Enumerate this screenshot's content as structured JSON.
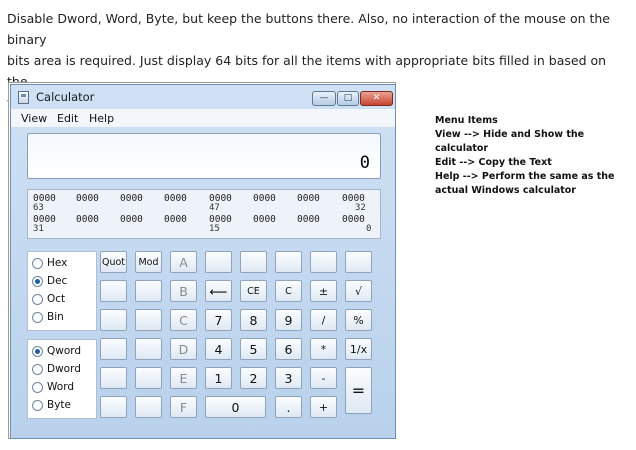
{
  "instructions": [
    "Disable Dword, Word, Byte, but keep the buttons there. Also, no interaction of the mouse on the binary",
    "bits area is required. Just display 64 bits for all the items with appropriate bits filled in based on the",
    "value in the number field."
  ],
  "window": {
    "title": "Calculator",
    "controls": {
      "minimize": "—",
      "maximize": "□",
      "close": "✕"
    }
  },
  "menu": [
    "View",
    "Edit",
    "Help"
  ],
  "display": {
    "value": "0"
  },
  "bits": {
    "groups_row1": [
      "0000",
      "0000",
      "0000",
      "0000",
      "0000",
      "0000",
      "0000",
      "0000"
    ],
    "groups_row2": [
      "0000",
      "0000",
      "0000",
      "0000",
      "0000",
      "0000",
      "0000",
      "0000"
    ],
    "labels_row1": [
      "63",
      "47",
      "32"
    ],
    "labels_row2": [
      "31",
      "15",
      "0"
    ]
  },
  "radios": {
    "base": [
      {
        "label": "Hex",
        "selected": false
      },
      {
        "label": "Dec",
        "selected": true
      },
      {
        "label": "Oct",
        "selected": false
      },
      {
        "label": "Bin",
        "selected": false
      }
    ],
    "word": [
      {
        "label": "Qword",
        "selected": true
      },
      {
        "label": "Dword",
        "selected": false
      },
      {
        "label": "Word",
        "selected": false
      },
      {
        "label": "Byte",
        "selected": false
      }
    ]
  },
  "buttons": {
    "quot": "Quot",
    "mod": "Mod",
    "A": "A",
    "B": "B",
    "C": "C",
    "D": "D",
    "E": "E",
    "F": "F",
    "backspace": "⟵",
    "ce": "CE",
    "c": "C",
    "plusminus": "±",
    "sqrt": "√",
    "n7": "7",
    "n8": "8",
    "n9": "9",
    "divide": "/",
    "percent": "%",
    "n4": "4",
    "n5": "5",
    "n6": "6",
    "multiply": "*",
    "reciprocal": "1/x",
    "n1": "1",
    "n2": "2",
    "n3": "3",
    "minus": "-",
    "equals": "=",
    "n0": "0",
    "dot": ".",
    "plus": "+"
  },
  "notes": [
    "Menu Items",
    "View --> Hide and Show the calculator",
    "Edit --> Copy the Text",
    "Help --> Perform the same as the",
    "actual Windows calculator"
  ]
}
